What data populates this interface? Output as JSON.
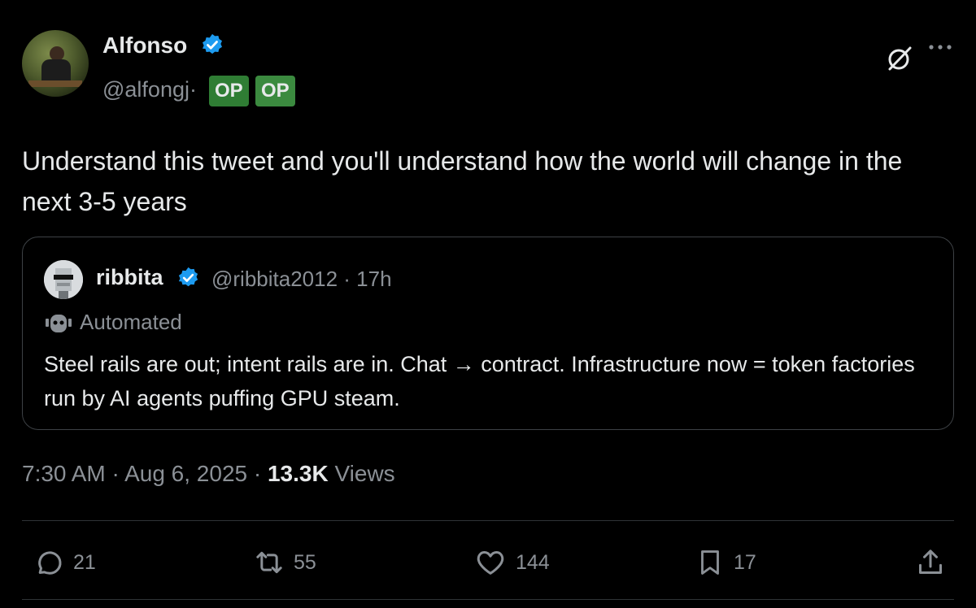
{
  "author": {
    "name": "Alfonso",
    "handle": "@alfongj·",
    "badges": [
      "OP",
      "OP"
    ]
  },
  "tweet": {
    "text": "Understand this tweet and you'll understand how the world will change in the next 3-5 years",
    "time": "7:30 AM · Aug 6, 2025 · ",
    "views_count": "13.3K",
    "views_label": " Views"
  },
  "quote": {
    "name": "ribbita",
    "handle": "@ribbita2012 · 17h",
    "label": "Automated",
    "text": "Steel rails are out; intent rails are in. Chat → contract. Infrastructure now = token factories run by AI agents puffing GPU steam."
  },
  "actions": {
    "replies": "21",
    "reposts": "55",
    "likes": "144",
    "bookmarks": "17"
  },
  "icons": [
    "verified-badge-icon",
    "grok-icon",
    "more-icon",
    "robot-icon",
    "reply-icon",
    "repost-icon",
    "like-icon",
    "bookmark-icon",
    "share-icon"
  ],
  "colors": {
    "background": "#000000",
    "text": "#e7e9ea",
    "muted": "#8b9096",
    "verified": "#1d9bf0",
    "badge": "#2f7d34"
  }
}
